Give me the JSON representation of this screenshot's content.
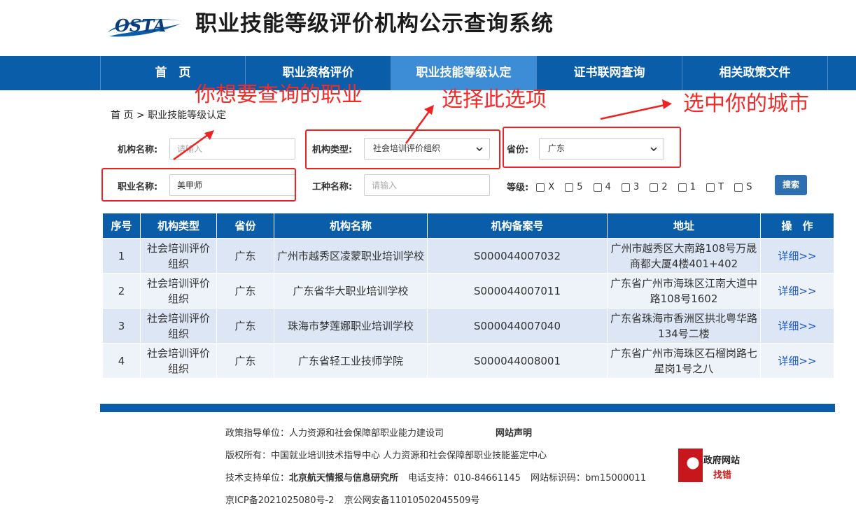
{
  "header": {
    "logo_text": "OSTA",
    "title": "职业技能等级评价机构公示查询系统"
  },
  "nav": {
    "items": [
      {
        "label": "首　页"
      },
      {
        "label": "职业资格评价"
      },
      {
        "label": "职业技能等级认定"
      },
      {
        "label": "证书联网查询"
      },
      {
        "label": "相关政策文件"
      }
    ],
    "active_index": 2
  },
  "breadcrumb": "首 页 > 职业技能等级认定",
  "form": {
    "org_name_label": "机构名称:",
    "org_name_placeholder": "请输入",
    "org_type_label": "机构类型:",
    "org_type_value": "社会培训评价组织",
    "province_label": "省份:",
    "province_value": "广东",
    "occupation_label": "职业名称:",
    "occupation_value": "美甲师",
    "job_type_label": "工种名称:",
    "job_type_placeholder": "请输入",
    "level_label": "等级:",
    "levels": [
      "X",
      "5",
      "4",
      "3",
      "2",
      "1",
      "T",
      "S"
    ],
    "search_label": "搜索"
  },
  "annotations": {
    "occupation_hint": "你想要查询的职业",
    "type_hint": "选择此选项",
    "city_hint": "选中你的城市",
    "color": "#ee2222"
  },
  "table": {
    "headers": [
      "序号",
      "机构类型",
      "省份",
      "机构名称",
      "机构备案号",
      "地址",
      "操　作"
    ],
    "rows": [
      {
        "no": "1",
        "type": "社会培训评价组织",
        "province": "广东",
        "name": "广州市越秀区凌蒙职业培训学校",
        "record": "S000044007032",
        "address": "广州市越秀区大南路108号万晟商都大厦4楼401+402",
        "action": "详细>>"
      },
      {
        "no": "2",
        "type": "社会培训评价组织",
        "province": "广东",
        "name": "广东省华大职业培训学校",
        "record": "S000044007011",
        "address": "广东省广州市海珠区江南大道中路108号1602",
        "action": "详细>>"
      },
      {
        "no": "3",
        "type": "社会培训评价组织",
        "province": "广东",
        "name": "珠海市梦莲娜职业培训学校",
        "record": "S000044007040",
        "address": "广东省珠海市香洲区拱北粤华路134号二楼",
        "action": "详细>>"
      },
      {
        "no": "4",
        "type": "社会培训评价组织",
        "province": "广东",
        "name": "广东省轻工业技师学院",
        "record": "S000044008001",
        "address": "广东省广州市海珠区石榴岗路七星岗1号之八",
        "action": "详细>>"
      }
    ]
  },
  "footer": {
    "policy_label": "政策指导单位：",
    "policy_value": "人力资源和社会保障部职业能力建设司",
    "statement": "网站声明",
    "copyright_label": "版权所有：",
    "copyright_value": "中国就业培训技术指导中心  人力资源和社会保障部职业技能鉴定中心",
    "tech_label": "技术支持单位：",
    "tech_value": "北京航天情报与信息研究所",
    "phone_label": "电话支持：",
    "phone_value": "010-84661145",
    "site_id_label": "网站标识码：",
    "site_id_value": "bm15000011",
    "icp": "京ICP备2021025080号-2",
    "police": "京公网安备11010502045509号",
    "gov_line1": "政府网站",
    "gov_line2": "找错"
  },
  "colors": {
    "brand_blue": "#0a5da8",
    "nav_active": "#3d8cd6",
    "row_odd": "#dde6f4",
    "row_even": "#eef2f9",
    "link": "#1a56c8",
    "annotation_red": "#ee2222"
  }
}
